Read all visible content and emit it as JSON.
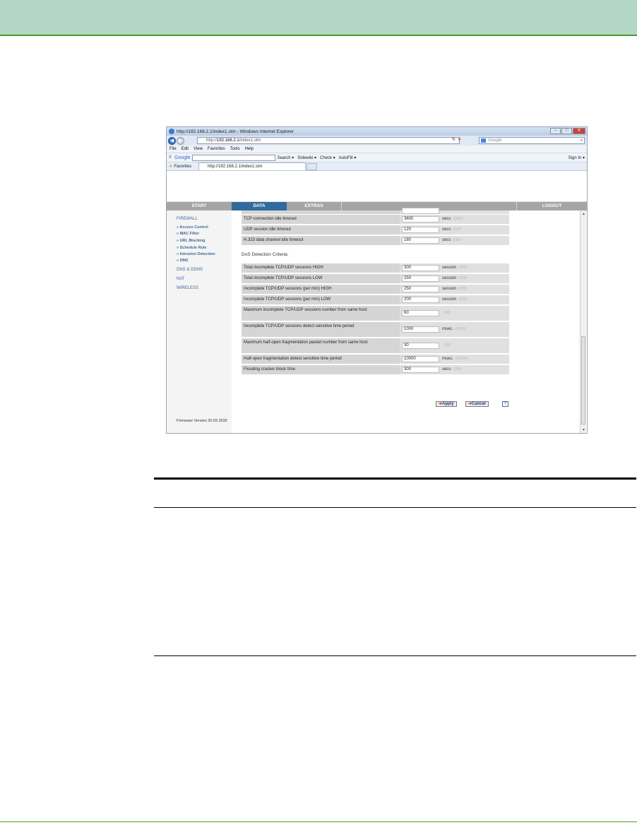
{
  "window": {
    "title": "http://192.168.2.1/index1.stm - Windows Internet Explorer",
    "address_prefix": "http://",
    "address_host": "192.168.2.1",
    "address_path": "/index1.stm",
    "search_placeholder": "Google"
  },
  "menu": [
    "File",
    "Edit",
    "View",
    "Favorites",
    "Tools",
    "Help"
  ],
  "google_toolbar": {
    "close": "X",
    "logo": "Google",
    "items": [
      "Search ▾",
      "Sidewiki ▾",
      "Check ▾",
      "AutoFill ▾"
    ],
    "sign_in": "Sign In ▾"
  },
  "favorites": {
    "label": "Favorites",
    "tab": "http://192.168.2.1/index1.stm"
  },
  "nav": {
    "start": "START",
    "data": "DATA",
    "extras": "EXTRAS",
    "logout": "LOGOUT"
  },
  "sidebar": {
    "firewall": "FIREWALL",
    "sub": [
      "» Access Control",
      "» MAC Filter",
      "» URL Blocking",
      "» Schedule Rule",
      "» Intrusion Detection",
      "» DMZ"
    ],
    "dns": "DNS & DDNS",
    "nat": "NAT",
    "wireless": "WIRELESS",
    "firmware": "Firmware Version 20.03.3032"
  },
  "timeouts": [
    {
      "label": "TCP connection idle timeout",
      "value": "3600",
      "unit": "secs",
      "default": "(3600)"
    },
    {
      "label": "UDP session idle timeout",
      "value": "120",
      "unit": "secs",
      "default": "(120)"
    },
    {
      "label": "H.323 data channel idle timeout",
      "value": "180",
      "unit": "secs",
      "default": "(180)"
    }
  ],
  "dos_title": "DoS Detection Criteria:",
  "dos": [
    {
      "label": "Total incomplete TCP/UDP sessions HIGH",
      "value": "300",
      "unit": "session",
      "default": "(300)"
    },
    {
      "label": "Total incomplete TCP/UDP sessions LOW",
      "value": "250",
      "unit": "session",
      "default": "(250)"
    },
    {
      "label": "Incomplete TCP/UDP sessions (per min) HIGH",
      "value": "250",
      "unit": "session",
      "default": "(250)"
    },
    {
      "label": "Incomplete TCP/UDP sessions (per min) LOW",
      "value": "200",
      "unit": "session",
      "default": "(200)"
    },
    {
      "label": "Maximum incomplete TCP/UDP sessions number from same host",
      "value": "60",
      "unit": "",
      "default": "(60)"
    },
    {
      "label": "Incomplete TCP/UDP sessions detect sensitive time period",
      "value": "1000",
      "unit": "msec.",
      "default": "(1000)"
    },
    {
      "label": "Maximum half-open fragmentation packet number from same host",
      "value": "30",
      "unit": "",
      "default": "(30)"
    },
    {
      "label": "Half-open fragmentation detect sensitive time period",
      "value": "10000",
      "unit": "msec.",
      "default": "(10000)"
    },
    {
      "label": "Flooding cracker block time",
      "value": "300",
      "unit": "secs",
      "default": "(300)"
    }
  ],
  "buttons": {
    "apply": "Apply",
    "cancel": "Cancel",
    "help": "?"
  }
}
